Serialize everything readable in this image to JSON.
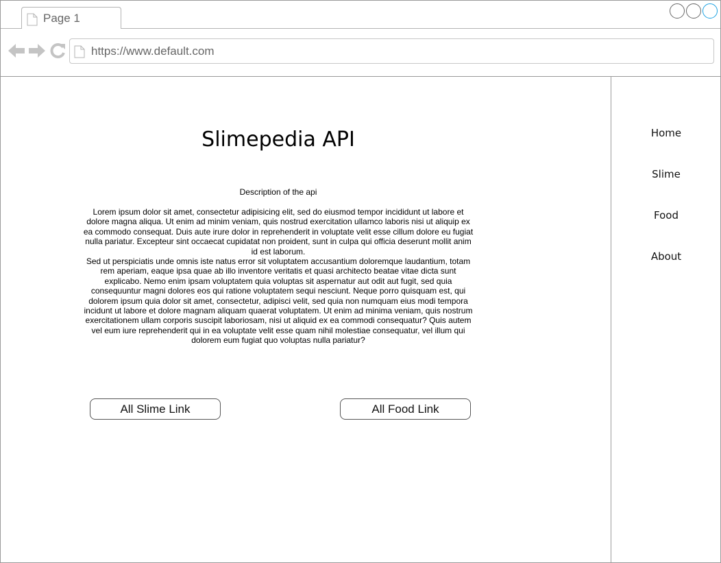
{
  "browser": {
    "tab_title": "Page 1",
    "url": "https://www.default.com",
    "accent_color": "#1ba1e2"
  },
  "icons": {
    "page": "page-icon",
    "back": "back-arrow-icon",
    "forward": "forward-arrow-icon",
    "refresh": "refresh-icon"
  },
  "main": {
    "title": "Slimepedia API",
    "description_heading": "Description of the api",
    "description_paragraphs": [
      "Lorem ipsum dolor sit amet, consectetur adipisicing elit, sed do eiusmod tempor incididunt ut labore et dolore magna aliqua. Ut enim ad minim veniam, quis nostrud exercitation ullamco laboris nisi ut aliquip ex ea commodo consequat. Duis aute irure dolor in reprehenderit in voluptate velit esse cillum dolore eu fugiat nulla pariatur. Excepteur sint occaecat cupidatat non proident, sunt in culpa qui officia deserunt mollit anim id est laborum.",
      "Sed ut perspiciatis unde omnis iste natus error sit voluptatem accusantium doloremque laudantium, totam rem aperiam, eaque ipsa quae ab illo inventore veritatis et quasi architecto beatae vitae dicta sunt explicabo. Nemo enim ipsam voluptatem quia voluptas sit aspernatur aut odit aut fugit, sed quia consequuntur magni dolores eos qui ratione voluptatem sequi nesciunt. Neque porro quisquam est, qui dolorem ipsum quia dolor sit amet, consectetur, adipisci velit, sed quia non numquam eius modi tempora incidunt ut labore et dolore magnam aliquam quaerat voluptatem. Ut enim ad minima veniam, quis nostrum exercitationem ullam corporis suscipit laboriosam, nisi ut aliquid ex ea commodi consequatur? Quis autem vel eum iure reprehenderit qui in ea voluptate velit esse quam nihil molestiae consequatur, vel illum qui dolorem eum fugiat quo voluptas nulla pariatur?"
    ],
    "buttons": {
      "slime": "All Slime Link",
      "food": "All Food Link"
    }
  },
  "sidebar": {
    "items": [
      {
        "label": "Home"
      },
      {
        "label": "Slime"
      },
      {
        "label": "Food"
      },
      {
        "label": "About"
      }
    ]
  }
}
